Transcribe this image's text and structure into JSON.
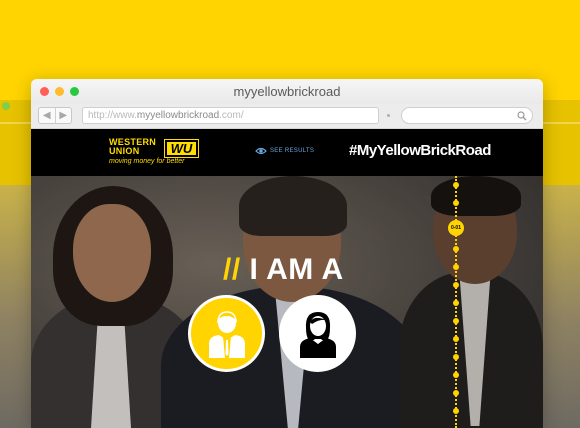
{
  "window": {
    "title": "myyellowbrickroad",
    "url_prefix": "http://www.",
    "url_domain": "myyellowbrickroad",
    "url_suffix": ".com/"
  },
  "site": {
    "logo_text_line1": "WESTERN",
    "logo_text_line2": "UNION",
    "logo_mark": "WU",
    "logo_tagline": "moving money for better",
    "see_results_label": "SEE RESULTS",
    "hashtag": "#MyYellowBrickRoad"
  },
  "hero": {
    "slash": "//",
    "headline": " I AM A",
    "choices": [
      "male",
      "female"
    ],
    "road_node_label": "0-01"
  },
  "colors": {
    "accent": "#ffd400",
    "header_bg": "#000000",
    "link_blue": "#6aa9e0"
  },
  "icons": [
    "back-arrow-icon",
    "forward-arrow-icon",
    "search-icon",
    "eye-icon",
    "businessman-icon",
    "businesswoman-icon"
  ]
}
